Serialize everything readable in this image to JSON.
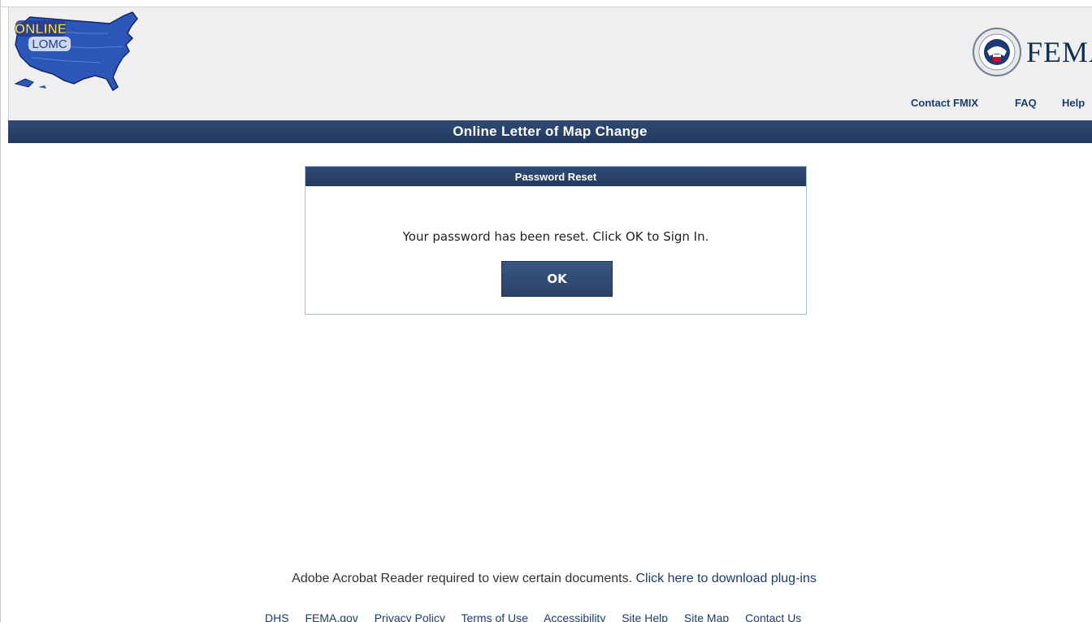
{
  "header": {
    "logo_line1": "ONLINE",
    "logo_line2": "LOMC",
    "agency": "FEMA",
    "nav": {
      "contact": "Contact FMIX",
      "faq": "FAQ",
      "help": "Help"
    }
  },
  "title_bar": {
    "title": "Online Letter of Map Change"
  },
  "dialog": {
    "title": "Password Reset",
    "message": "Your password has been reset. Click OK to Sign In.",
    "ok_label": "OK"
  },
  "footer": {
    "note": "Adobe Acrobat Reader required to view certain documents.",
    "plugin_link": "Click here to download plug-ins",
    "links": [
      "DHS",
      "FEMA.gov",
      "Privacy Policy",
      "Terms of Use",
      "Accessibility",
      "Site Help",
      "Site Map",
      "Contact Us"
    ]
  },
  "colors": {
    "navy": "#233a5e",
    "header_bg": "#efefef",
    "link": "#1c3c6e"
  }
}
